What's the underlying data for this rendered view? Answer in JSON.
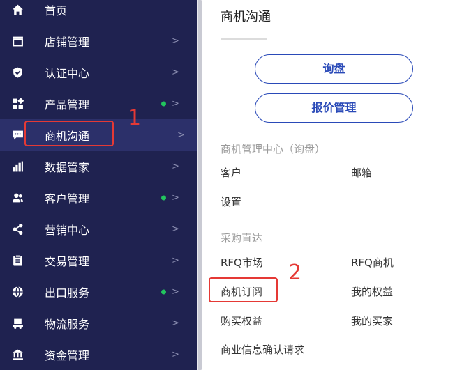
{
  "sidebar": {
    "items": [
      {
        "label": "首页",
        "icon": "home-icon"
      },
      {
        "label": "店铺管理",
        "icon": "store-icon",
        "arrow": ">"
      },
      {
        "label": "认证中心",
        "icon": "shield-icon",
        "arrow": ">"
      },
      {
        "label": "产品管理",
        "icon": "grid-icon",
        "arrow": ">",
        "dot": true
      },
      {
        "label": "商机沟通",
        "icon": "chat-icon",
        "arrow": ">",
        "active": true
      },
      {
        "label": "数据管家",
        "icon": "bar-chart-icon",
        "arrow": ">"
      },
      {
        "label": "客户管理",
        "icon": "users-icon",
        "arrow": ">",
        "dot": true
      },
      {
        "label": "营销中心",
        "icon": "share-icon",
        "arrow": ">"
      },
      {
        "label": "交易管理",
        "icon": "clipboard-icon",
        "arrow": ">"
      },
      {
        "label": "出口服务",
        "icon": "globe-icon",
        "arrow": ">",
        "dot": true
      },
      {
        "label": "物流服务",
        "icon": "truck-icon",
        "arrow": ">"
      },
      {
        "label": "资金管理",
        "icon": "bank-icon",
        "arrow": ">"
      }
    ]
  },
  "panel": {
    "title": "商机沟通",
    "buttons": {
      "inquiry": "询盘",
      "quote": "报价管理"
    },
    "section1": {
      "title": "商机管理中心（询盘）",
      "links": [
        "客户",
        "邮箱",
        "设置"
      ]
    },
    "section2": {
      "title": "采购直达",
      "links": [
        "RFQ市场",
        "RFQ商机",
        "商机订阅",
        "我的权益",
        "购买权益",
        "我的买家",
        "商业信息确认请求"
      ]
    }
  },
  "annotations": {
    "one": "1",
    "two": "2"
  },
  "colors": {
    "sidebar_bg": "#1f2250",
    "sidebar_active": "#2c306a",
    "accent_blue": "#2a4ab8",
    "highlight_red": "#e53935",
    "dot_green": "#22c55e"
  }
}
